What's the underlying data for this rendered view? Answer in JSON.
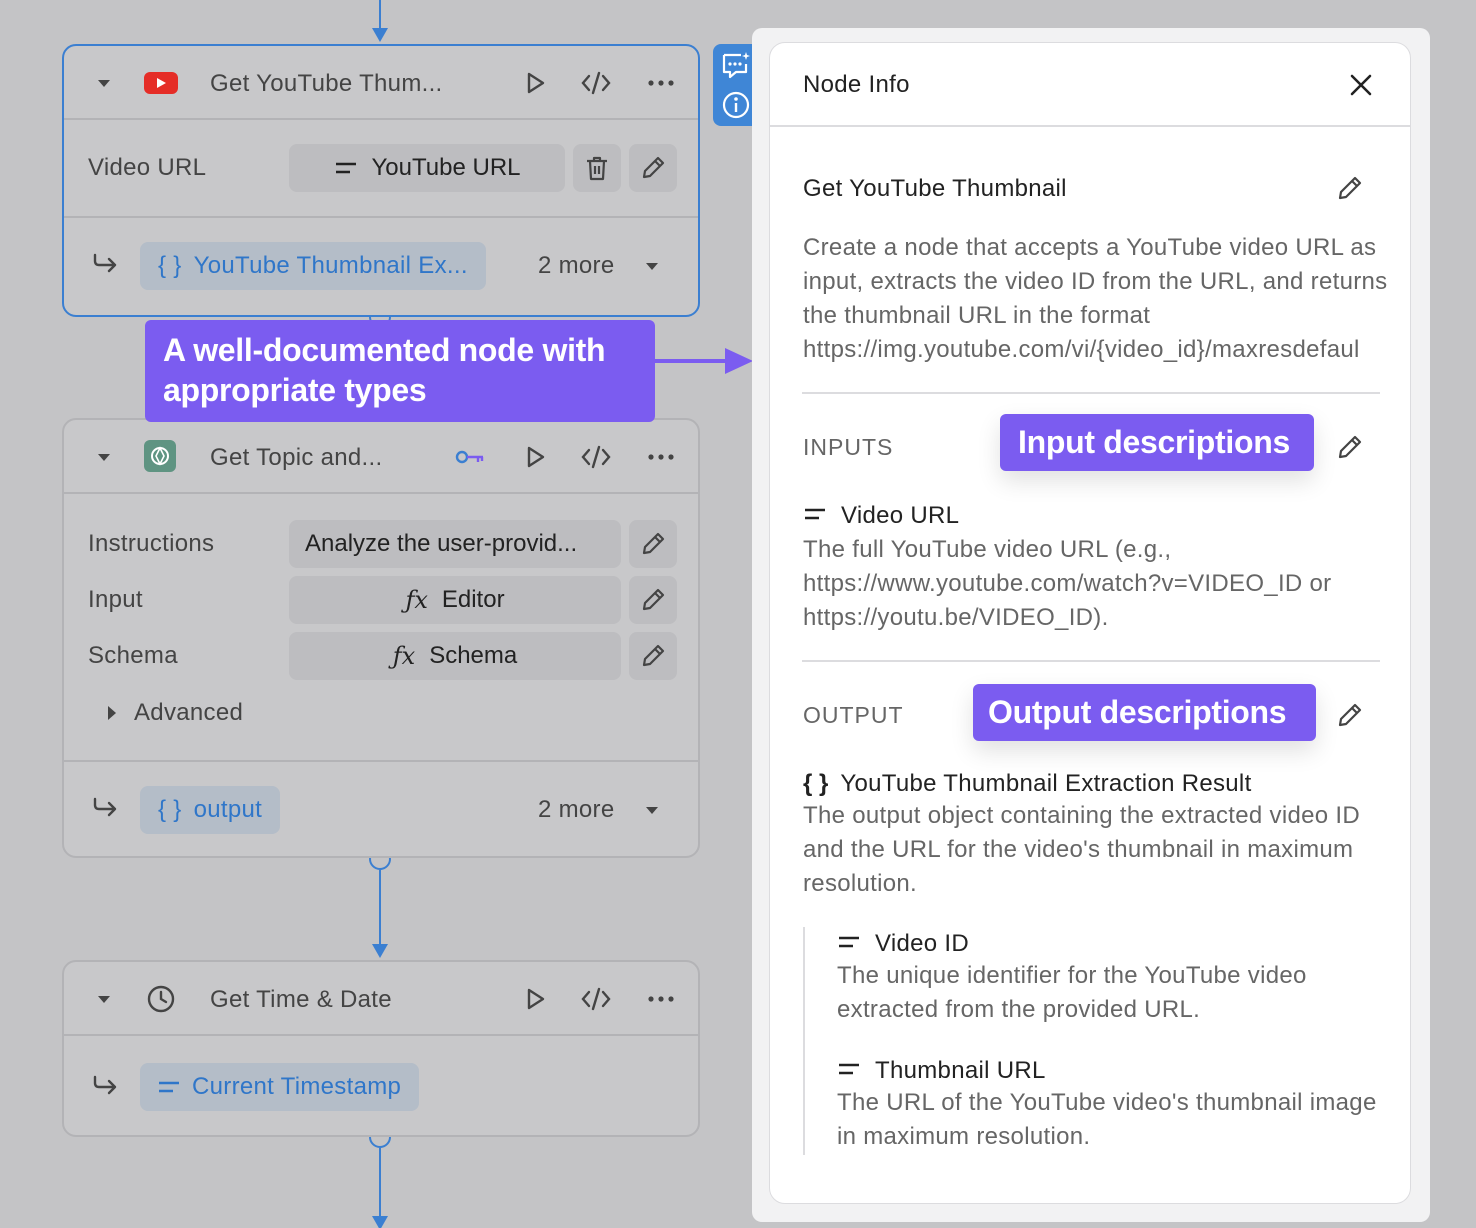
{
  "canvas": {
    "nodes": [
      {
        "title": "Get YouTube Thum...",
        "icon": "youtube-icon",
        "fields": [
          {
            "label": "Video URL",
            "value": "YouTube URL",
            "value_icon": "text-type-icon"
          }
        ],
        "output": {
          "label": "YouTube Thumbnail Ex...",
          "icon": "object-type-icon",
          "more": "2 more"
        }
      },
      {
        "title": "Get Topic and...",
        "icon": "openai-icon",
        "fields": [
          {
            "label": "Instructions",
            "value": "Analyze the user-provid..."
          },
          {
            "label": "Input",
            "value": "Editor",
            "value_icon": "function-icon"
          },
          {
            "label": "Schema",
            "value": "Schema",
            "value_icon": "function-icon"
          }
        ],
        "advanced_label": "Advanced",
        "output": {
          "label": "output",
          "icon": "object-type-icon",
          "more": "2 more"
        }
      },
      {
        "title": "Get Time & Date",
        "icon": "clock-icon",
        "output": {
          "label": "Current Timestamp",
          "icon": "text-type-icon"
        }
      }
    ],
    "colors": {
      "accent": "#3b7fd1",
      "callout": "#7b5cf0",
      "canvas_bg": "#c4c4c6"
    }
  },
  "callouts": {
    "node": "A well-documented node with appropriate types",
    "inputs": "Input descriptions",
    "output": "Output descriptions"
  },
  "panel": {
    "title": "Node Info",
    "node_name": "Get YouTube Thumbnail",
    "node_description": "Create a node that accepts a YouTube video URL as input, extracts the video ID from the URL, and returns the thumbnail URL in the format https://img.youtube.com/vi/{video_id}/maxresdefaul",
    "inputs_label": "INPUTS",
    "inputs": [
      {
        "name": "Video URL",
        "description": "The full YouTube video URL (e.g., https://www.youtube.com/watch?v=VIDEO_ID or https://youtu.be/VIDEO_ID)."
      }
    ],
    "output_label": "OUTPUT",
    "output": {
      "name": "YouTube Thumbnail Extraction Result",
      "description": "The output object containing the extracted video ID and the URL for the video's thumbnail in maximum resolution.",
      "fields": [
        {
          "name": "Video ID",
          "description": "The unique identifier for the YouTube video extracted from the provided URL."
        },
        {
          "name": "Thumbnail URL",
          "description": "The URL of the YouTube video's thumbnail image in maximum resolution."
        }
      ]
    }
  }
}
